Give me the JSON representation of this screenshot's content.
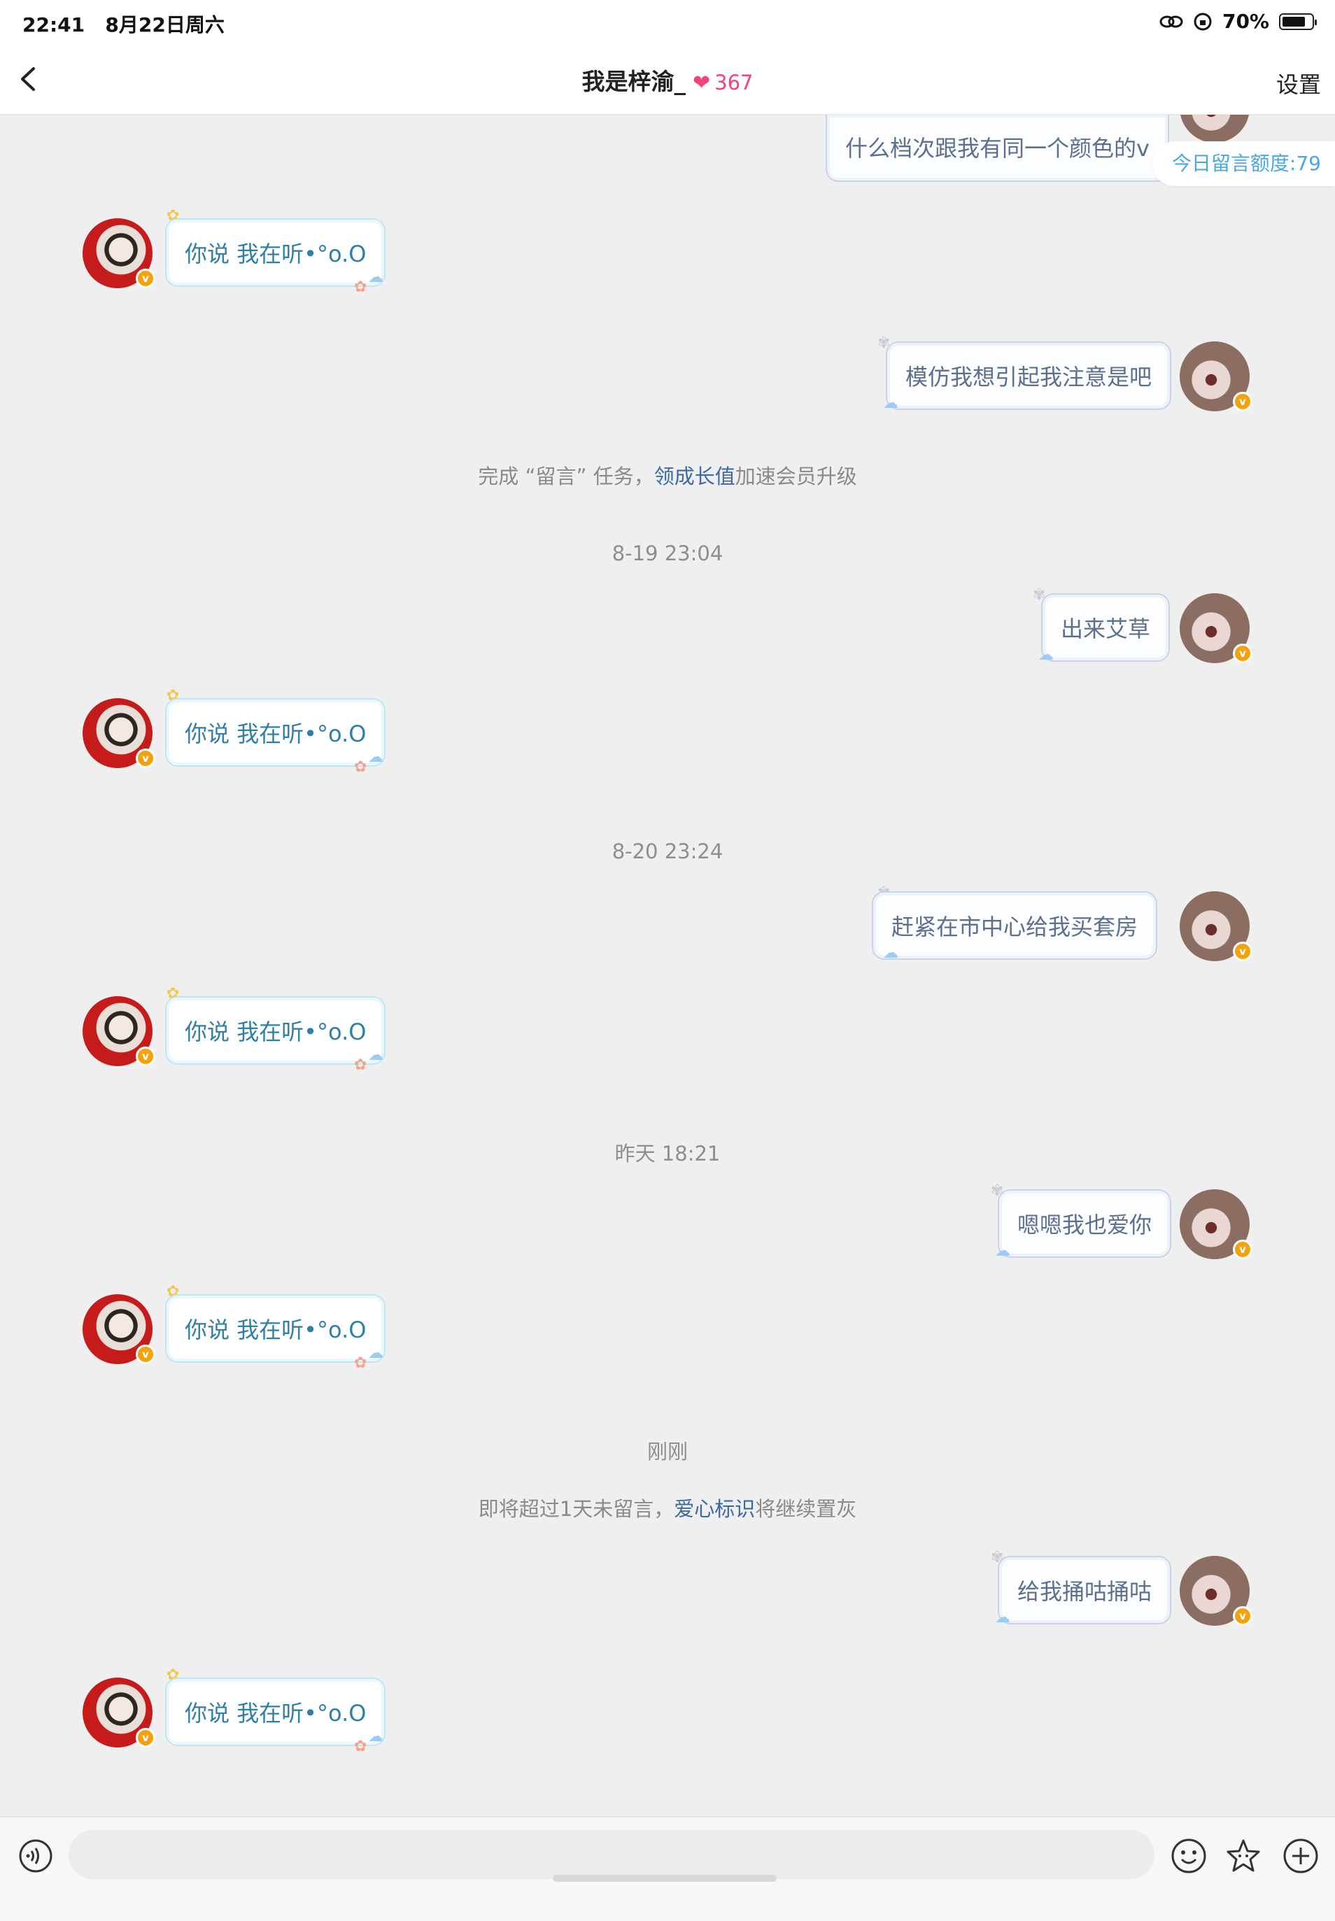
{
  "status_bar": {
    "time": "22:41",
    "date": "8月22日周六",
    "battery": "70%"
  },
  "header": {
    "title": "我是梓渝_",
    "heart_icon": "heart-icon",
    "heart_count": "367",
    "settings_label": "设置"
  },
  "quota": "今日留言额度:79",
  "top_partial_message": "什么档次跟我有同一个颜色的v",
  "reply_text": "你说 我在听•°o.O",
  "messages": {
    "m1": "模仿我想引起我注意是吧",
    "m2": "出来艾草",
    "m3": "赶紧在市中心给我买套房",
    "m4": "嗯嗯我也爱你",
    "m5": "给我捅咕捅咕"
  },
  "system": {
    "task_pre": "完成 “留言” 任务，",
    "task_link": "领成长值",
    "task_post": "加速会员升级",
    "warn_pre": "即将超过1天未留言，",
    "warn_link": "爱心标识",
    "warn_post": "将继续置灰"
  },
  "times": {
    "t1": "8-19 23:04",
    "t2": "8-20 23:24",
    "t3": "昨天 18:21",
    "t4": "刚刚"
  },
  "badge_label": "v",
  "input": {
    "placeholder": ""
  },
  "colors": {
    "accent_blue": "#4aa8e0",
    "heart_pink": "#f0457a",
    "badge_orange": "#f5a10a",
    "link_blue": "#3b6aa3"
  }
}
